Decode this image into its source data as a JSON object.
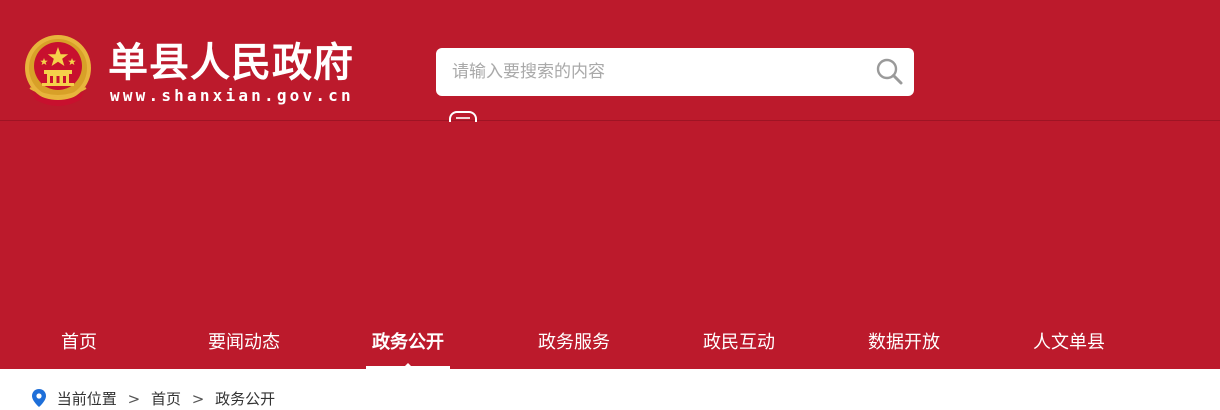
{
  "header": {
    "site_title": "单县人民政府",
    "site_domain": "www.shanxian.gov.cn",
    "emblem_icon": "national-emblem-icon",
    "background_color": "#bc1a2c"
  },
  "search": {
    "placeholder": "请输入要搜索的内容",
    "value": "",
    "button_icon": "search-icon"
  },
  "nav": {
    "items": [
      {
        "label": "首页",
        "active": false
      },
      {
        "label": "要闻动态",
        "active": false
      },
      {
        "label": "政务公开",
        "active": true
      },
      {
        "label": "政务服务",
        "active": false
      },
      {
        "label": "政民互动",
        "active": false
      },
      {
        "label": "数据开放",
        "active": false
      },
      {
        "label": "人文单县",
        "active": false
      }
    ]
  },
  "breadcrumb": {
    "prefix": "当前位置",
    "items": [
      "首页",
      "政务公开"
    ],
    "separator": ">",
    "icon": "location-pin-icon"
  }
}
